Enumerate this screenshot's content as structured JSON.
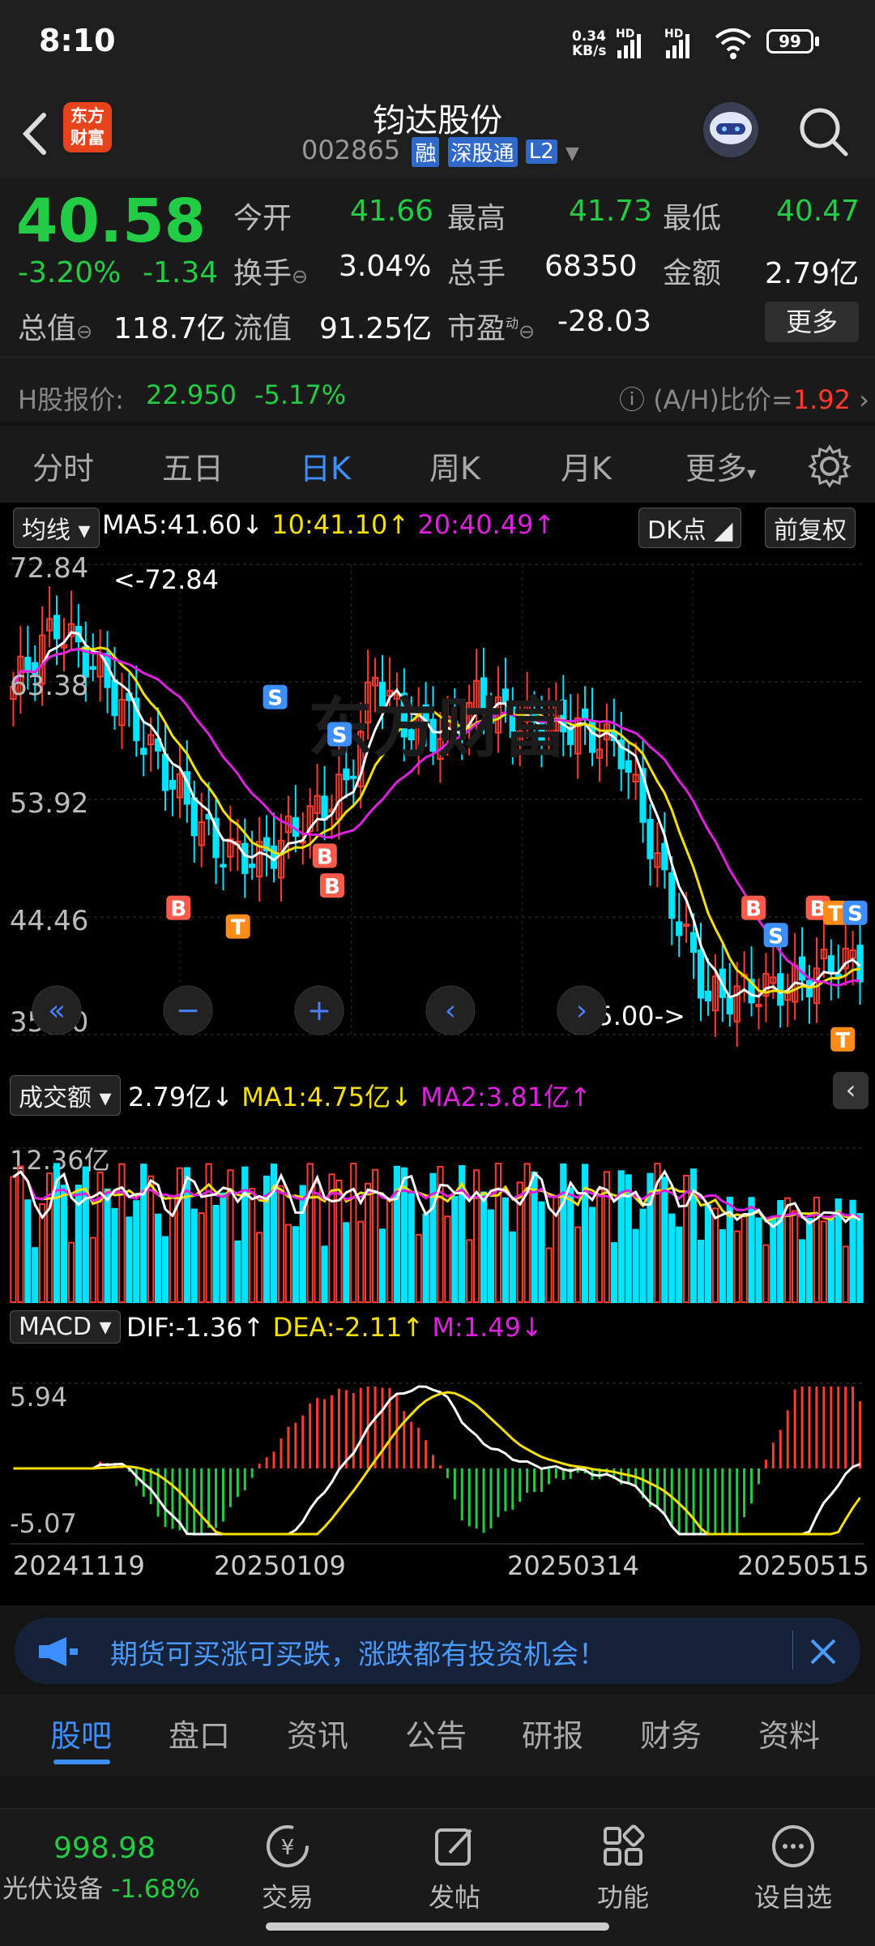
{
  "status": {
    "time": "8:10",
    "network_speed_top": "0.34",
    "network_speed_bottom": "KB/s",
    "hd1": "HD",
    "hd2": "HD",
    "battery": "99"
  },
  "header": {
    "logo_text_1": "东方",
    "logo_text_2": "财富",
    "stock_name": "钧达股份",
    "stock_code": "002865",
    "tags": [
      "融",
      "深股通",
      "L2"
    ]
  },
  "quote": {
    "price": "40.58",
    "change_pct": "-3.20%",
    "change_abs": "-1.34",
    "open_label": "今开",
    "open": "41.66",
    "high_label": "最高",
    "high": "41.73",
    "low_label": "最低",
    "low": "40.47",
    "turnover_label": "换手",
    "turnover": "3.04%",
    "volume_label": "总手",
    "volume": "68350",
    "amount_label": "金额",
    "amount": "2.79亿",
    "mktcap_label": "总值",
    "mktcap": "118.7亿",
    "float_label": "流值",
    "float": "91.25亿",
    "pe_label": "市盈",
    "pe_sup": "动",
    "pe": "-28.03",
    "more_button": "更多",
    "h_label": "H股报价:",
    "h_price": "22.950",
    "h_change": "-5.17%",
    "ah_label": "(A/H)比价=",
    "ah_value": "1.92"
  },
  "tabs": {
    "items": [
      "分时",
      "五日",
      "日K",
      "周K",
      "月K",
      "更多"
    ],
    "active": 2
  },
  "kline": {
    "indicator_select": "均线",
    "ma5": "MA5:41.60",
    "ma10": "10:41.10",
    "ma20": "20:40.49",
    "dk_button": "DK点",
    "adjust_button": "前复权",
    "y_ticks": [
      "72.84",
      "63.38",
      "53.92",
      "44.46",
      "35.00"
    ],
    "max_note": "<-72.84",
    "min_note": "35.00->",
    "watermark": "东方财富",
    "markers": [
      "S",
      "S",
      "B",
      "B",
      "B",
      "T",
      "B",
      "S",
      "B",
      "T",
      "S",
      "T"
    ]
  },
  "volume": {
    "select": "成交额",
    "value": "2.79亿",
    "ma1": "MA1:4.75亿",
    "ma2": "MA2:3.81亿",
    "y_top": "12.36亿"
  },
  "macd": {
    "select": "MACD",
    "dif": "DIF:-1.36",
    "dea": "DEA:-2.11",
    "m": "M:1.49",
    "y_top": "5.94",
    "y_bottom": "-5.07"
  },
  "x_axis": [
    "20241119",
    "20250109",
    "20250314",
    "20250515"
  ],
  "banner": {
    "text": "期货可买涨可买跌，涨跌都有投资机会！"
  },
  "bottom_tabs": {
    "items": [
      "股吧",
      "盘口",
      "资讯",
      "公告",
      "研报",
      "财务",
      "资料"
    ],
    "active": 0
  },
  "nav": {
    "index_value": "998.98",
    "index_name": "光伏设备",
    "index_change": "-1.68%",
    "items": [
      "交易",
      "发帖",
      "功能",
      "设自选"
    ]
  },
  "colors": {
    "up": "#ff3b30",
    "down": "#22cc44",
    "accent": "#3d8fff",
    "candle_down": "#00e5ff"
  }
}
